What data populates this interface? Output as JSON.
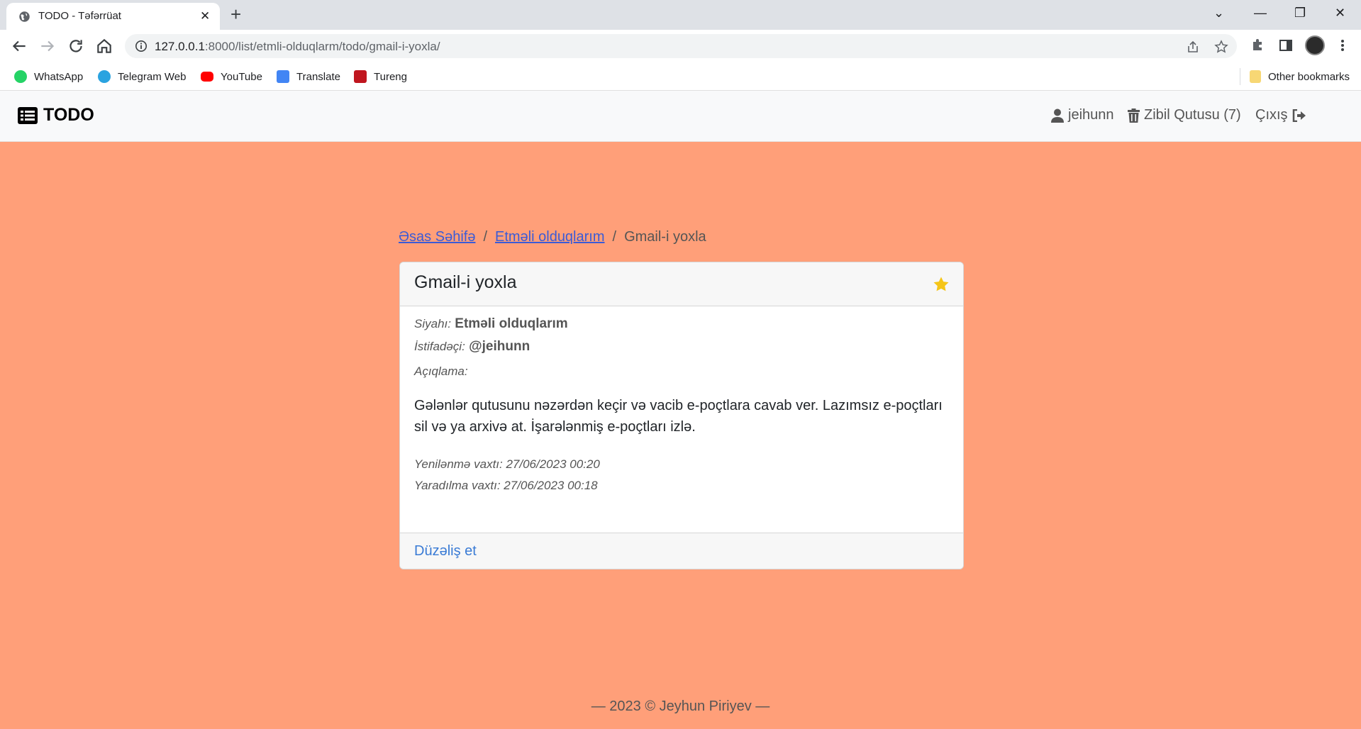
{
  "browser": {
    "tab_title": "TODO - Təfərrüat",
    "url_host": "127.0.0.1",
    "url_rest": ":8000/list/etmli-olduqlarm/todo/gmail-i-yoxla/",
    "bookmarks": [
      "WhatsApp",
      "Telegram Web",
      "YouTube",
      "Translate",
      "Tureng"
    ],
    "other_bookmarks": "Other bookmarks"
  },
  "navbar": {
    "brand": "TODO",
    "user": "jeihunn",
    "trash": "Zibil Qutusu (7)",
    "logout": "Çıxış"
  },
  "breadcrumb": {
    "home": "Əsas Səhifə",
    "list": "Etməli olduqlarım",
    "current": "Gmail-i yoxla"
  },
  "todo": {
    "title": "Gmail-i yoxla",
    "list_label": "Siyahı:",
    "list_value": "Etməli olduqlarım",
    "user_label": "İstifadəçi:",
    "user_value": "@jeihunn",
    "desc_label": "Açıqlama:",
    "description": "Gələnlər qutusunu nəzərdən keçir və vacib e-poçtlara cavab ver. Lazımsız e-poçtları sil və ya arxivə at. İşarələnmiş e-poçtları izlə.",
    "updated": "Yenilənmə vaxtı: 27/06/2023 00:20",
    "created": "Yaradılma vaxtı: 27/06/2023 00:18",
    "edit_label": "Düzəliş et",
    "starred": true,
    "star_color": "#f5c518"
  },
  "footer": "— 2023 © Jeyhun Piriyev —",
  "colors": {
    "page_bg": "#ff9f79",
    "link": "#3b5bd6"
  }
}
